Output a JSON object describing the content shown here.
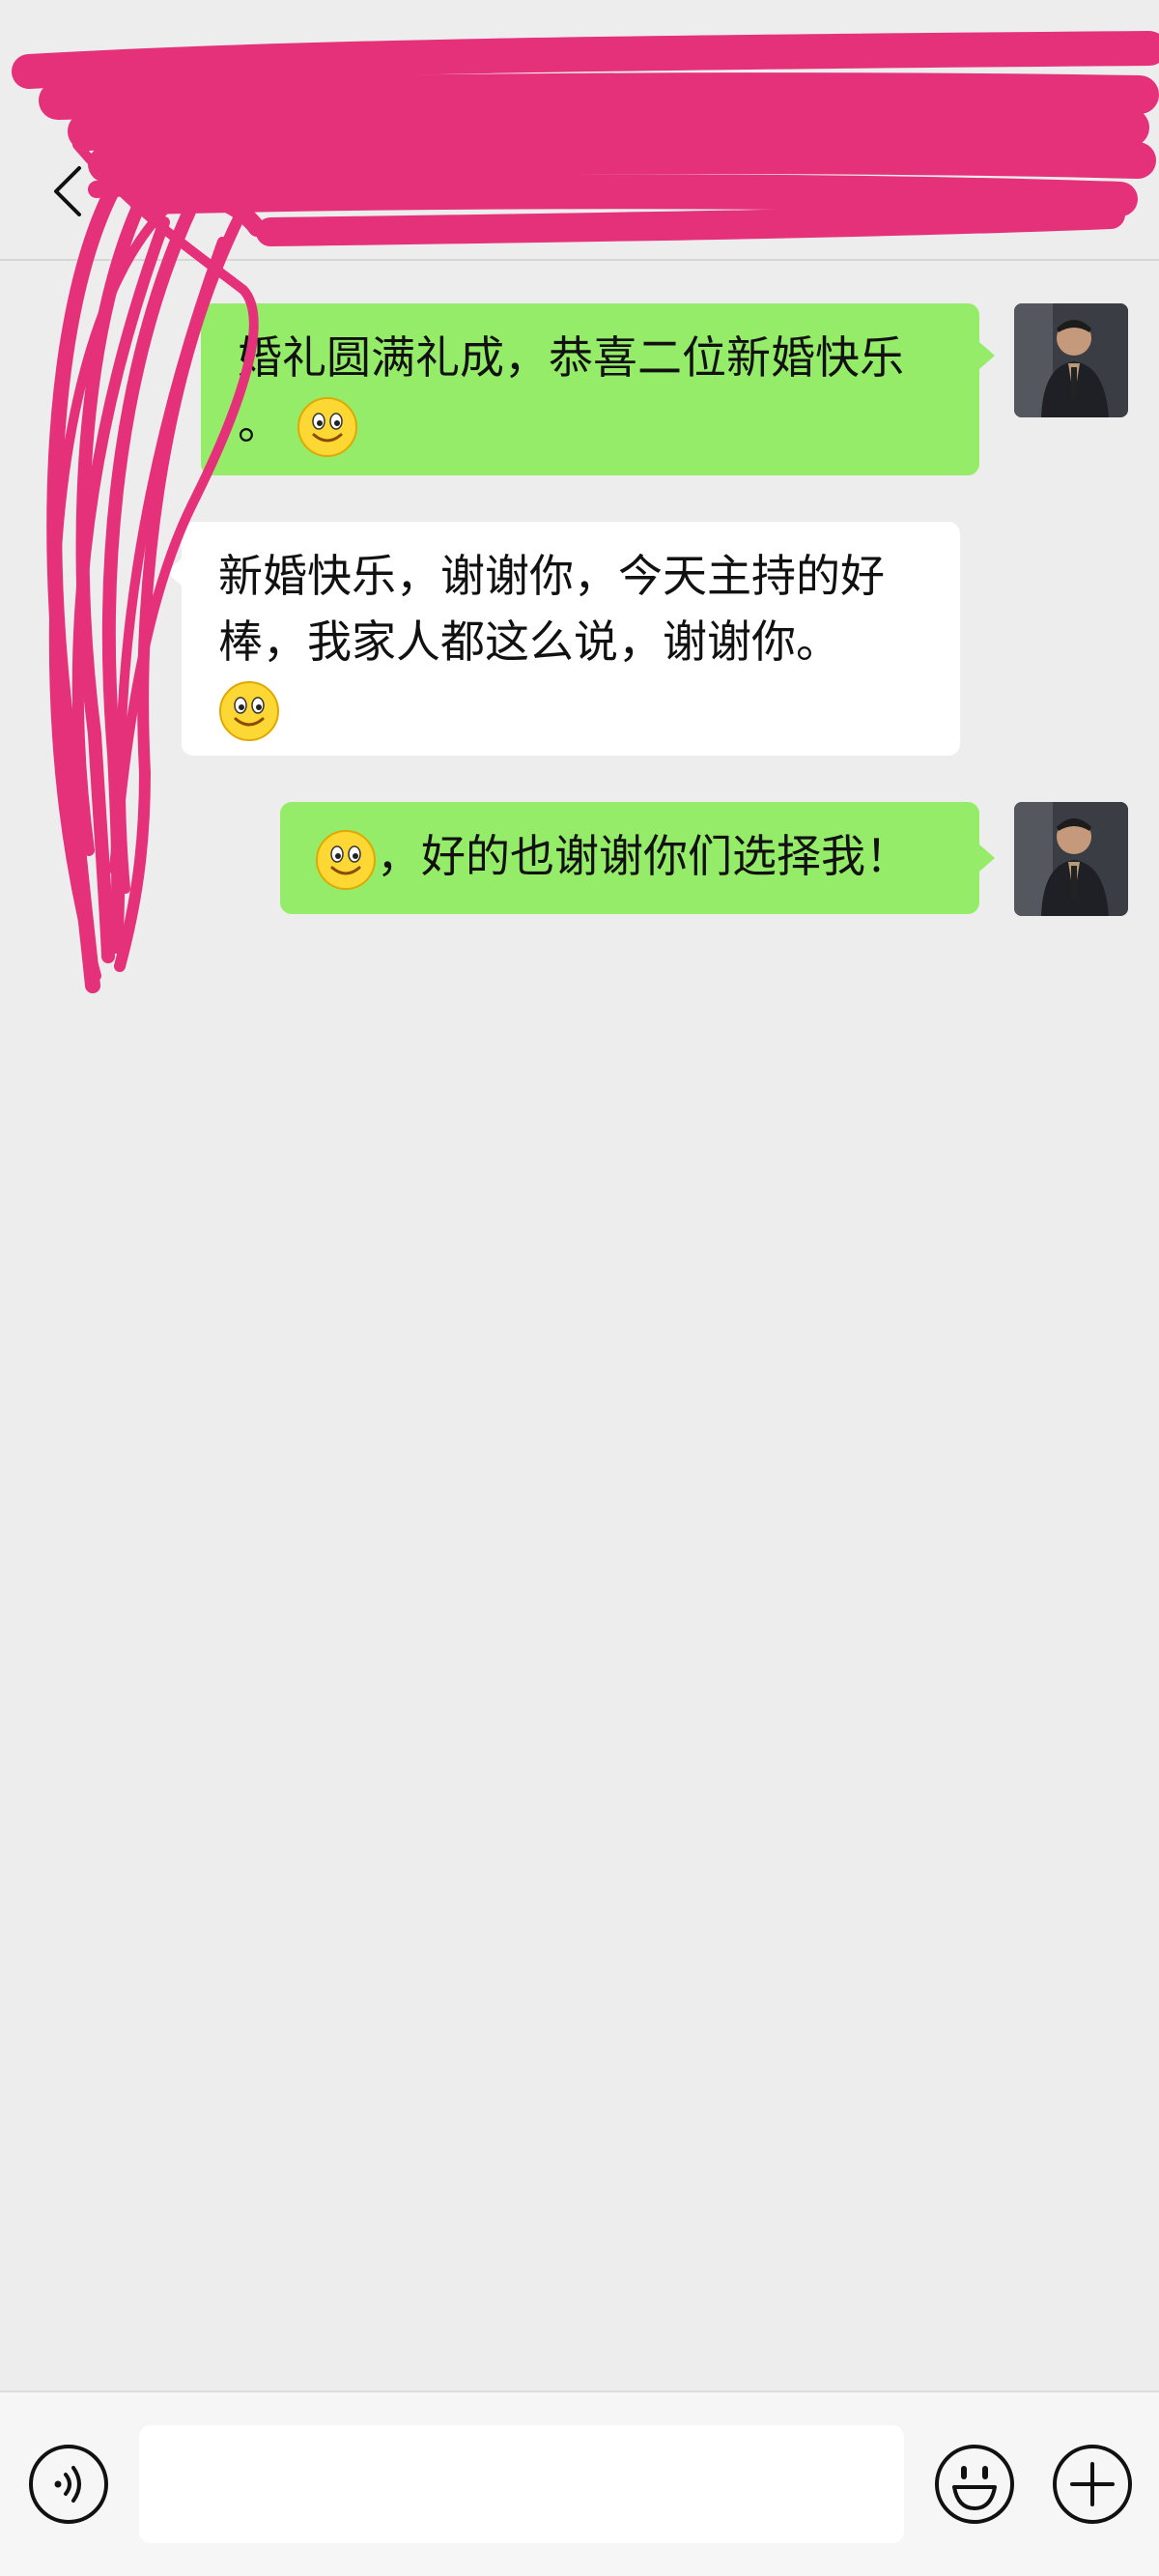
{
  "messages": [
    {
      "side": "right",
      "text_line1": "婚礼圆满礼成，恭喜二位新婚快乐",
      "text_line2": "。",
      "emoji": "smile-emoji"
    },
    {
      "side": "left",
      "text_line1": "新婚快乐，谢谢你，今天主持的好",
      "text_line2": "棒，我家人都这么说，谢谢你。",
      "emoji": "smile-emoji"
    },
    {
      "side": "right",
      "text": "，好的也谢谢你们选择我！",
      "emoji": "smile-emoji"
    }
  ],
  "input": {
    "placeholder": "",
    "value": ""
  },
  "colors": {
    "background": "#ededed",
    "sent_bubble": "#95ec69",
    "received_bubble": "#ffffff",
    "scribble": "#e5307a"
  }
}
